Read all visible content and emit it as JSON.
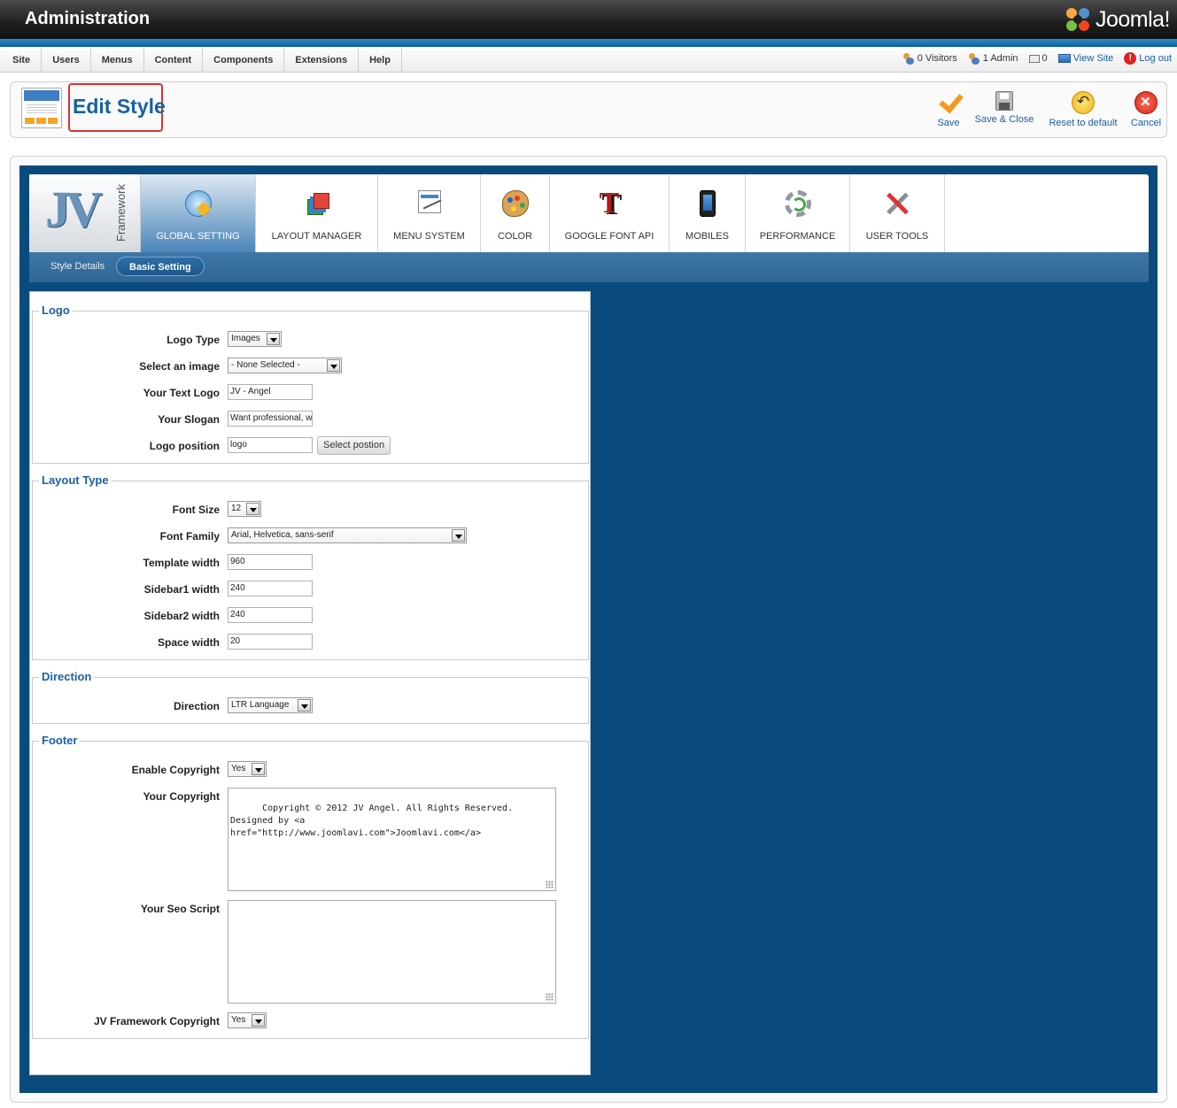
{
  "header": {
    "title": "Administration",
    "brand": "Joomla!"
  },
  "menu": {
    "items": [
      "Site",
      "Users",
      "Menus",
      "Content",
      "Components",
      "Extensions",
      "Help"
    ]
  },
  "status": {
    "visitors": "0 Visitors",
    "admins": "1 Admin",
    "messages": "0",
    "view_site": "View Site",
    "logout": "Log out"
  },
  "toolbar": {
    "page_title": "Edit Style",
    "save": "Save",
    "save_close": "Save & Close",
    "reset": "Reset to default",
    "cancel": "Cancel"
  },
  "framework": {
    "logo_letters": "JV",
    "logo_word": "Framework",
    "tabs": [
      {
        "label": "GLOBAL SETTING",
        "icon": "global-setting-icon",
        "active": true
      },
      {
        "label": "LAYOUT MANAGER",
        "icon": "layout-manager-icon",
        "active": false
      },
      {
        "label": "MENU SYSTEM",
        "icon": "menu-system-icon",
        "active": false
      },
      {
        "label": "COLOR",
        "icon": "palette-icon",
        "active": false
      },
      {
        "label": "GOOGLE FONT API",
        "icon": "font-icon",
        "active": false
      },
      {
        "label": "MOBILES",
        "icon": "mobile-phone-icon",
        "active": false
      },
      {
        "label": "PERFORMANCE",
        "icon": "gear-icon",
        "active": false
      },
      {
        "label": "USER TOOLS",
        "icon": "tools-icon",
        "active": false
      }
    ],
    "subtabs": [
      {
        "label": "Style Details",
        "active": false
      },
      {
        "label": "Basic Setting",
        "active": true
      }
    ]
  },
  "form": {
    "logo": {
      "legend": "Logo",
      "logo_type_label": "Logo Type",
      "logo_type_value": "Images",
      "select_image_label": "Select an image",
      "select_image_value": "- None Selected -",
      "text_logo_label": "Your Text Logo",
      "text_logo_value": "JV - Angel",
      "slogan_label": "Your Slogan",
      "slogan_value": "Want professional, w",
      "position_label": "Logo position",
      "position_value": "logo",
      "select_position_button": "Select postion"
    },
    "layout": {
      "legend": "Layout Type",
      "font_size_label": "Font Size",
      "font_size_value": "12",
      "font_family_label": "Font Family",
      "font_family_value": "Arial, Helvetica, sans-serif",
      "template_width_label": "Template width",
      "template_width_value": "960",
      "sidebar1_label": "Sidebar1 width",
      "sidebar1_value": "240",
      "sidebar2_label": "Sidebar2 width",
      "sidebar2_value": "240",
      "space_label": "Space width",
      "space_value": "20"
    },
    "direction": {
      "legend": "Direction",
      "direction_label": "Direction",
      "direction_value": "LTR Language"
    },
    "footer": {
      "legend": "Footer",
      "enable_copyright_label": "Enable Copyright",
      "enable_copyright_value": "Yes",
      "copyright_label": "Your Copyright",
      "copyright_value": "Copyright © 2012 JV Angel. All Rights Reserved.\nDesigned by <a\nhref=\"http://www.joomlavi.com\">Joomlavi.com</a>",
      "seo_label": "Your Seo Script",
      "seo_value": "",
      "jv_copyright_label": "JV Framework Copyright",
      "jv_copyright_value": "Yes"
    }
  },
  "colors": {
    "header_bg": "#1f1f1f",
    "accent_blue": "#1b5fa8",
    "panel_bg": "#0a4a7c",
    "title_highlight": "#d63331"
  }
}
